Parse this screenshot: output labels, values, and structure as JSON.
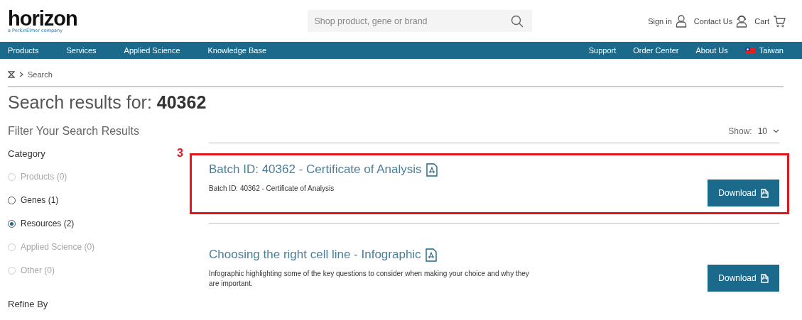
{
  "header": {
    "logo": "horizon",
    "logo_tagline": "a PerkinElmer company",
    "search": {
      "placeholder": "Shop product, gene or brand"
    },
    "links": [
      {
        "label": "Sign in"
      },
      {
        "label": "Contact Us"
      },
      {
        "label": "Cart"
      }
    ]
  },
  "nav": {
    "left": [
      "Products",
      "Services",
      "Applied Science",
      "Knowledge Base"
    ],
    "right": [
      "Support",
      "Order Center",
      "About Us"
    ],
    "region": "Taiwan"
  },
  "breadcrumb": [
    "Search"
  ],
  "title": "Search results for: **40362**",
  "filters": {
    "heading": "Filter Your Search Results",
    "category_label": "Category",
    "categories": [
      {
        "label": "Products (0)",
        "selected": false,
        "disabled": true
      },
      {
        "label": "Genes (1)",
        "selected": false,
        "disabled": false
      },
      {
        "label": "Resources (2)",
        "selected": true,
        "disabled": false
      },
      {
        "label": "Applied Science (0)",
        "selected": false,
        "disabled": true
      },
      {
        "label": "Other (0)",
        "selected": false,
        "disabled": true
      }
    ],
    "refine_label": "Refine By"
  },
  "show": {
    "label": "Show:",
    "value": "10"
  },
  "results": [
    {
      "title": "Batch ID: 40362 - Certificate of Analysis",
      "description": "Batch ID: 40362 - Certificate of Analysis",
      "button": "Download",
      "highlighted": true,
      "annotation": "3"
    },
    {
      "title": "Choosing the right cell line - Infographic",
      "description": "Infographic highlighting some of the key questions to consider when making your choice and why they are important.",
      "button": "Download",
      "highlighted": false
    }
  ]
}
